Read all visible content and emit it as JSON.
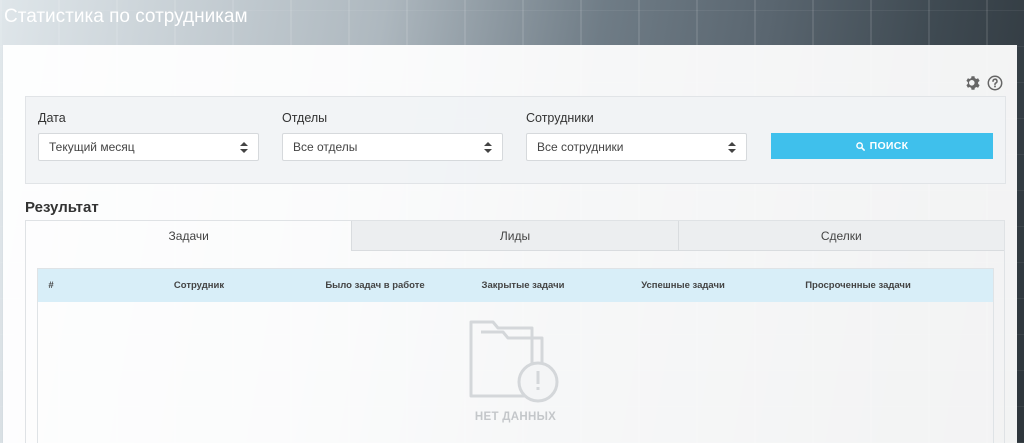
{
  "page": {
    "title": "Статистика по сотрудникам"
  },
  "icons": {
    "settings": "gear-icon",
    "help": "question-circle-icon",
    "search": "search-icon",
    "empty": "empty-folder-warning-icon"
  },
  "colors": {
    "accent": "#3fc0ec",
    "table_header": "#d8eef8"
  },
  "filters": {
    "date": {
      "label": "Дата",
      "value": "Текущий месяц"
    },
    "department": {
      "label": "Отделы",
      "value": "Все отделы"
    },
    "employee": {
      "label": "Сотрудники",
      "value": "Все сотрудники"
    },
    "search_label": "ПОИСК"
  },
  "result": {
    "title": "Результат",
    "tabs": [
      {
        "label": "Задачи",
        "active": true
      },
      {
        "label": "Лиды",
        "active": false
      },
      {
        "label": "Сделки",
        "active": false
      }
    ],
    "columns": [
      "#",
      "Сотрудник",
      "Было задач в работе",
      "Закрытые задачи",
      "Успешные задачи",
      "Просроченные задачи"
    ],
    "empty_text": "НЕТ ДАННЫХ"
  }
}
